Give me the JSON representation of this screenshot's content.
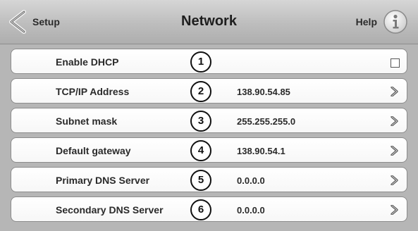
{
  "header": {
    "back_label": "Setup",
    "title": "Network",
    "help_label": "Help"
  },
  "rows": [
    {
      "label": "Enable DHCP",
      "number": "1",
      "value": "",
      "control": "checkbox"
    },
    {
      "label": "TCP/IP Address",
      "number": "2",
      "value": "138.90.54.85",
      "control": "chevron"
    },
    {
      "label": "Subnet mask",
      "number": "3",
      "value": "255.255.255.0",
      "control": "chevron"
    },
    {
      "label": "Default gateway",
      "number": "4",
      "value": "138.90.54.1",
      "control": "chevron"
    },
    {
      "label": "Primary DNS Server",
      "number": "5",
      "value": "0.0.0.0",
      "control": "chevron"
    },
    {
      "label": "Secondary DNS Server",
      "number": "6",
      "value": "0.0.0.0",
      "control": "chevron"
    }
  ],
  "colors": {
    "header_background": "#bdbdbd",
    "frame_background": "#b6b6b6",
    "row_background": "#ffffff",
    "text": "#2a2a2a"
  },
  "icons": {
    "back": "chevron-left-icon",
    "help": "info-icon",
    "row_arrow": "chevron-right-icon"
  }
}
